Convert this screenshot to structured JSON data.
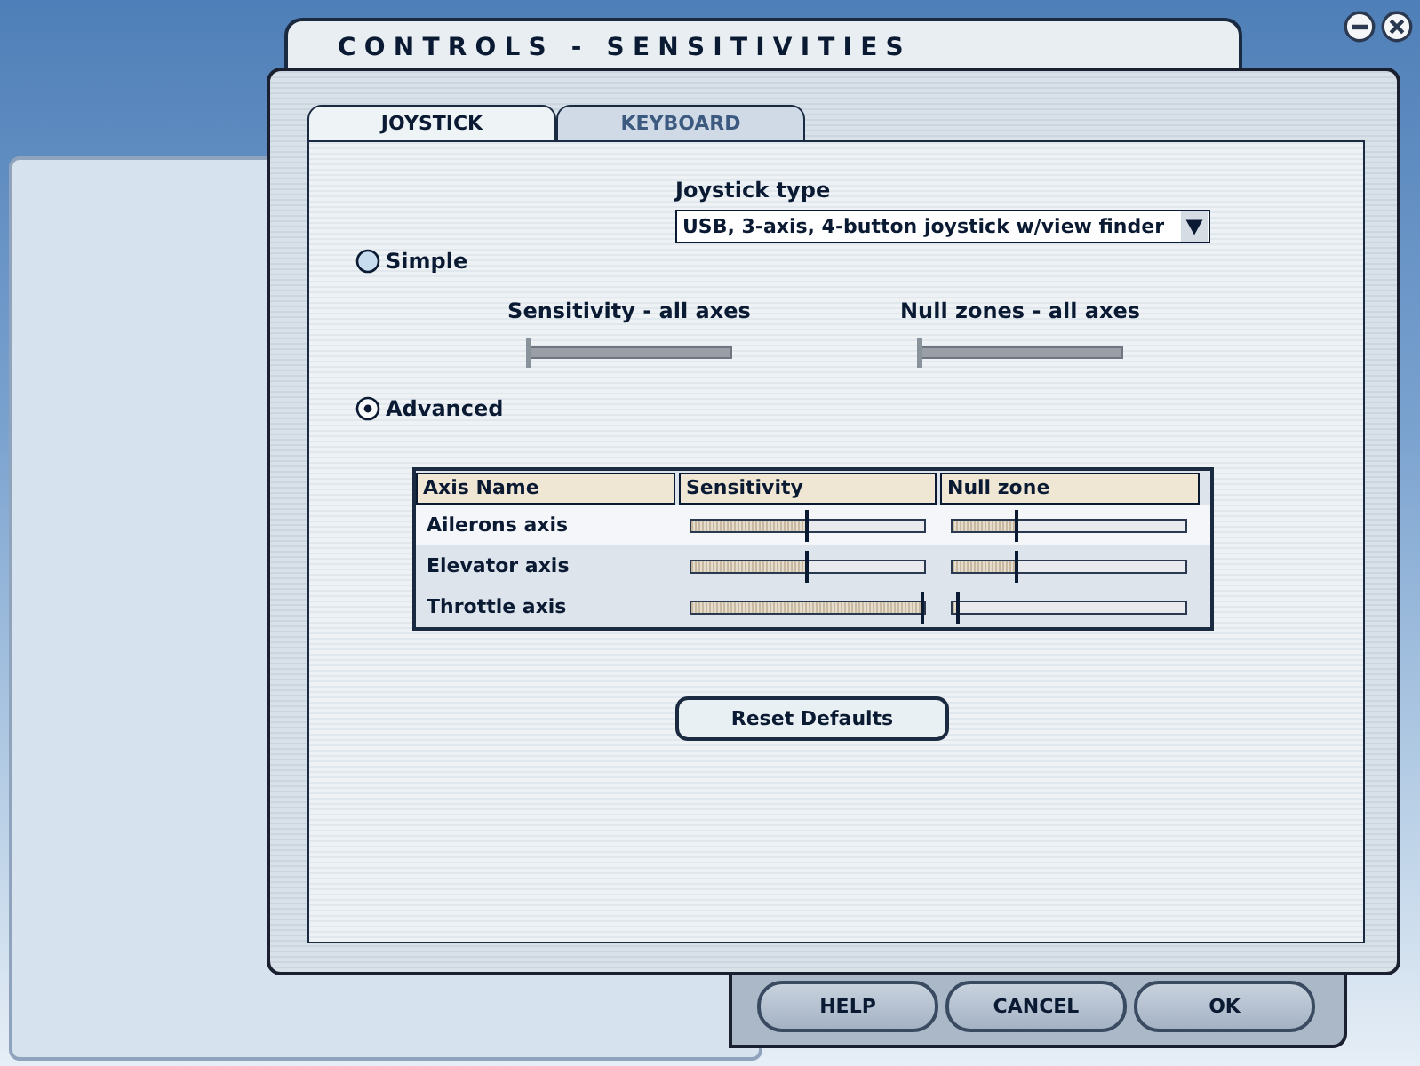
{
  "window": {
    "title": "CONTROLS - SENSITIVITIES"
  },
  "tabs": [
    {
      "label": "JOYSTICK",
      "selected": true
    },
    {
      "label": "KEYBOARD",
      "selected": false
    }
  ],
  "joystick_type": {
    "label": "Joystick type",
    "value": "USB, 3-axis, 4-button joystick w/view finder"
  },
  "modes": [
    {
      "label": "Simple",
      "selected": false
    },
    {
      "label": "Advanced",
      "selected": true
    }
  ],
  "simple_sliders": [
    {
      "label": "Sensitivity - all axes",
      "level": 0.0
    },
    {
      "label": "Null zones - all axes",
      "level": 0.0
    }
  ],
  "table": {
    "columns": [
      "Axis Name",
      "Sensitivity",
      "Null zone"
    ],
    "rows": [
      {
        "name": "Ailerons axis",
        "selected": true,
        "sensitivity": {
          "level": 0.5
        },
        "null_zone": {
          "level": 0.28
        }
      },
      {
        "name": "Elevator axis",
        "selected": false,
        "sensitivity": {
          "level": 0.5
        },
        "null_zone": {
          "level": 0.28
        }
      },
      {
        "name": "Throttle axis",
        "selected": false,
        "sensitivity": {
          "level": 1.0
        },
        "null_zone": {
          "level": 0.02
        }
      }
    ]
  },
  "reset_button": "Reset Defaults",
  "buttons": [
    "HELP",
    "CANCEL",
    "OK"
  ]
}
